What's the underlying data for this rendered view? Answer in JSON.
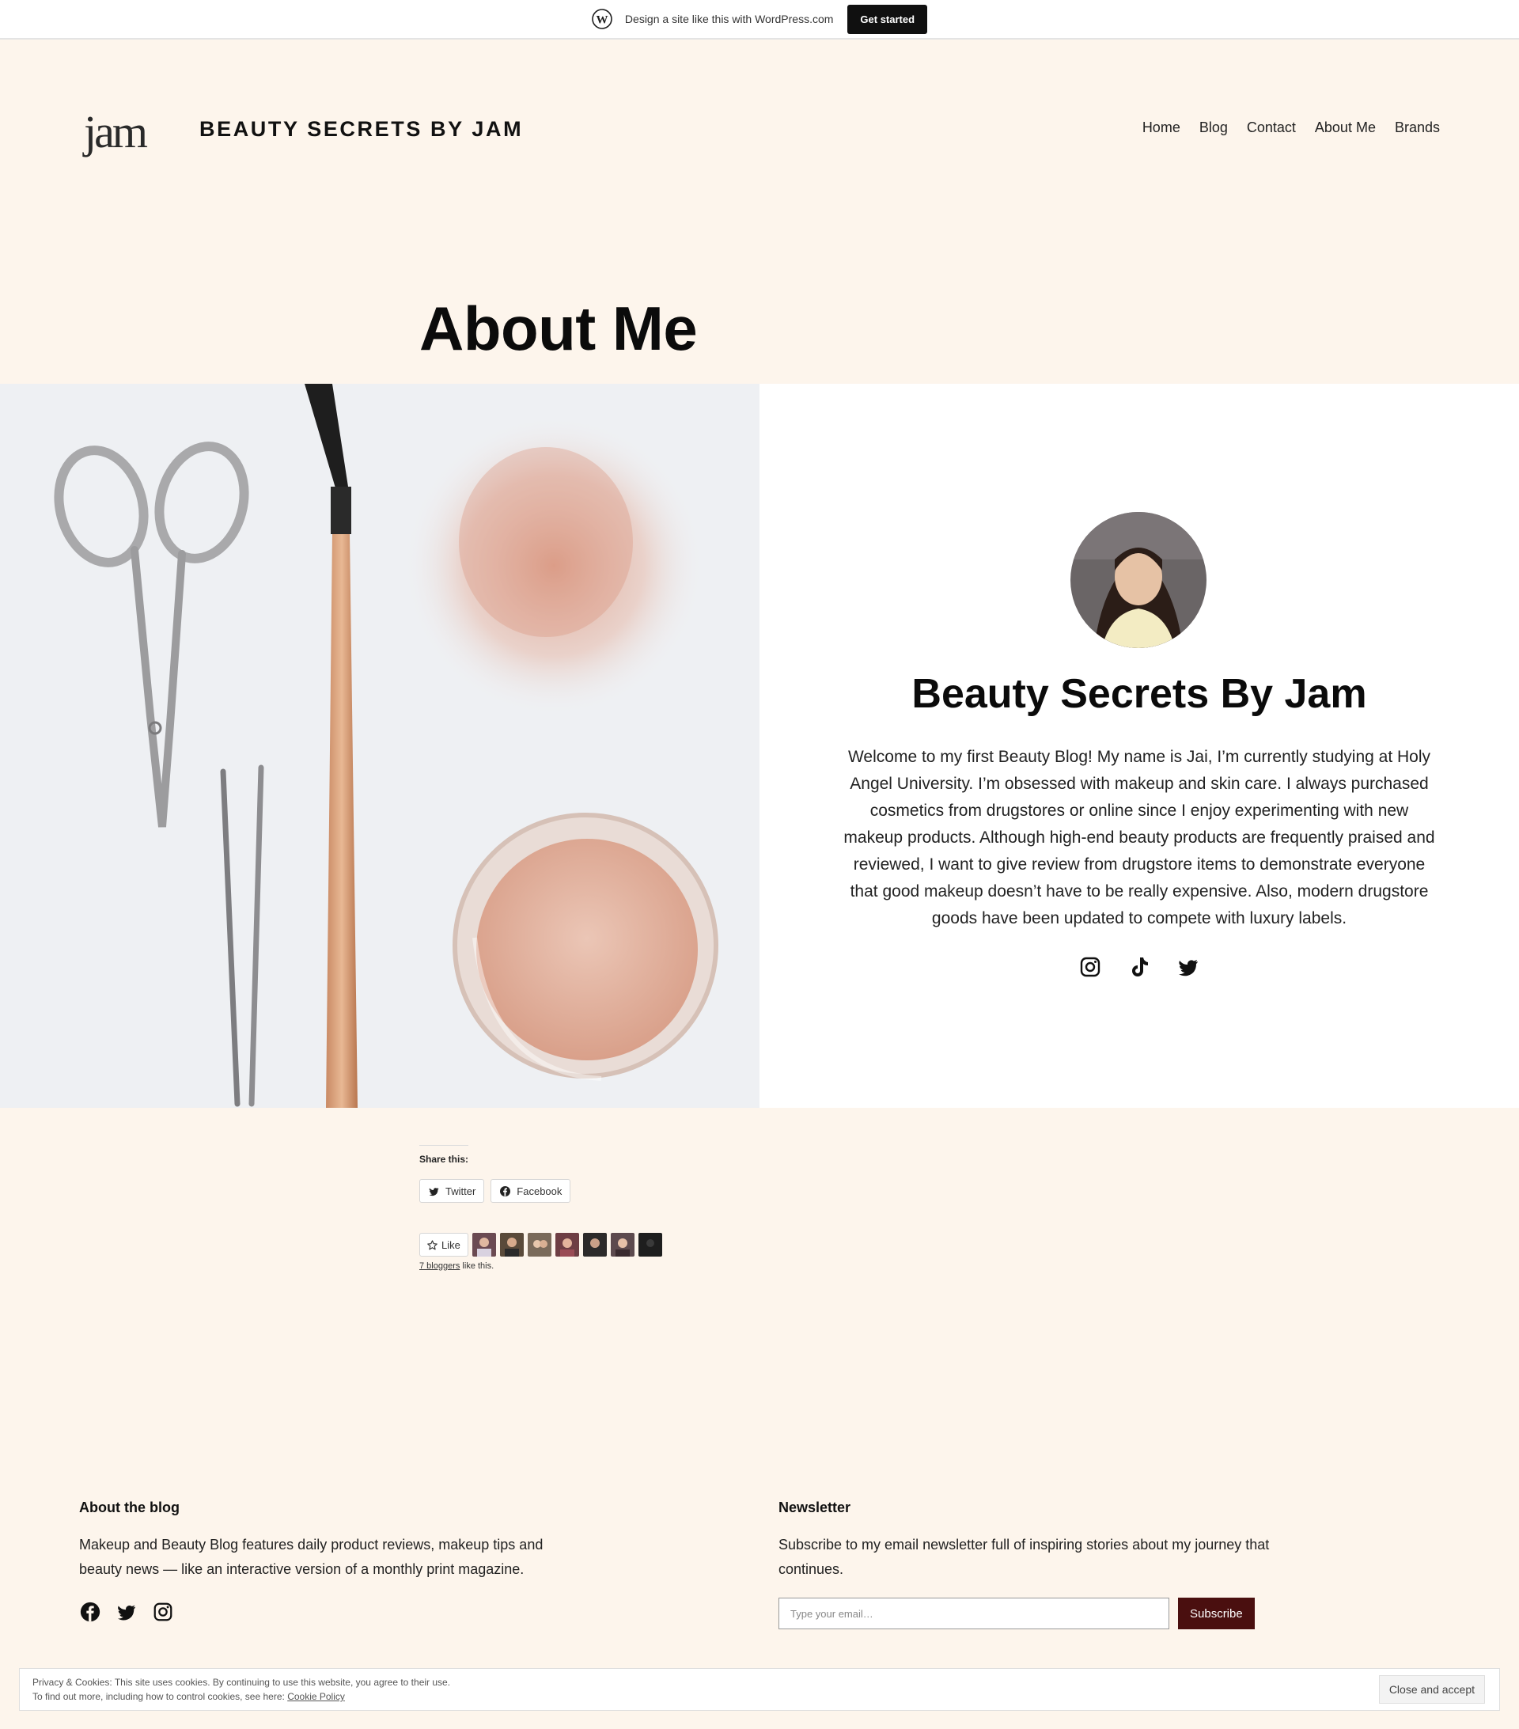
{
  "wpbar": {
    "text": "Design a site like this with WordPress.com",
    "cta": "Get started"
  },
  "site": {
    "logo_text": "jam",
    "title": "BEAUTY SECRETS BY JAM"
  },
  "nav": {
    "items": [
      {
        "label": "Home"
      },
      {
        "label": "Blog"
      },
      {
        "label": "Contact"
      },
      {
        "label": "About Me"
      },
      {
        "label": "Brands"
      }
    ]
  },
  "page": {
    "title": "About Me"
  },
  "profile": {
    "name": "Beauty Secrets By Jam",
    "bio": "Welcome to my first Beauty Blog! My name is Jai, I’m currently studying at Holy Angel University. I’m obsessed with makeup and skin care. I always purchased cosmetics from drugstores or online since I enjoy experimenting with new makeup products. Although high-end beauty products are frequently praised and reviewed, I want to give review from drugstore items to demonstrate everyone that good makeup doesn’t have to be really expensive. Also, modern drugstore goods have been updated to compete with luxury labels.",
    "social_icons": [
      "instagram-icon",
      "tiktok-icon",
      "twitter-icon"
    ]
  },
  "share": {
    "label": "Share this:",
    "buttons": [
      {
        "label": "Twitter",
        "icon": "twitter-icon"
      },
      {
        "label": "Facebook",
        "icon": "facebook-icon"
      }
    ]
  },
  "likes": {
    "button_label": "Like",
    "count_link": "7 bloggers",
    "suffix": " like this.",
    "avatar_colors": [
      "#6b4a52",
      "#5a4a3a",
      "#7a6a5a",
      "#6e3e44",
      "#2c2a2a",
      "#5d4a4e",
      "#1e1e1e"
    ]
  },
  "footer": {
    "about": {
      "heading": "About the blog",
      "text": "Makeup and Beauty Blog features daily product reviews, makeup tips and beauty news — like an interactive version of a monthly print magazine.",
      "social_icons": [
        "facebook-icon",
        "twitter-icon",
        "instagram-icon"
      ]
    },
    "newsletter": {
      "heading": "Newsletter",
      "text": "Subscribe to my email newsletter full of inspiring stories about my journey that continues.",
      "email_placeholder": "Type your email…",
      "subscribe_label": "Subscribe"
    }
  },
  "cookie": {
    "line1": "Privacy & Cookies: This site uses cookies. By continuing to use this website, you agree to their use.",
    "line2": "To find out more, including how to control cookies, see here: ",
    "link": "Cookie Policy",
    "button": "Close and accept"
  },
  "colors": {
    "background": "#fdf5ec",
    "accent": "#4a0f0f",
    "text": "#111111"
  }
}
